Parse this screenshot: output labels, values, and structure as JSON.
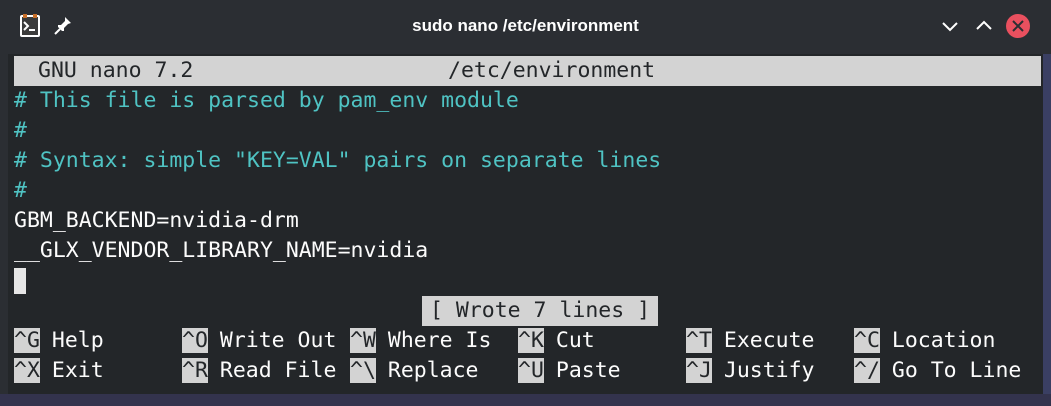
{
  "window": {
    "title": "sudo nano /etc/environment"
  },
  "editor": {
    "version": "GNU nano 7.2",
    "filename": "/etc/environment",
    "lines": [
      "# This file is parsed by pam_env module",
      "#",
      "# Syntax: simple \"KEY=VAL\" pairs on separate lines",
      "#",
      "GBM_BACKEND=nvidia-drm",
      "__GLX_VENDOR_LIBRARY_NAME=nvidia"
    ],
    "status": "[ Wrote 7 lines ]"
  },
  "shortcuts": {
    "row1": [
      {
        "key": "^G",
        "label": "Help"
      },
      {
        "key": "^O",
        "label": "Write Out"
      },
      {
        "key": "^W",
        "label": "Where Is"
      },
      {
        "key": "^K",
        "label": "Cut"
      },
      {
        "key": "^T",
        "label": "Execute"
      },
      {
        "key": "^C",
        "label": "Location"
      }
    ],
    "row2": [
      {
        "key": "^X",
        "label": "Exit"
      },
      {
        "key": "^R",
        "label": "Read File"
      },
      {
        "key": "^\\",
        "label": "Replace"
      },
      {
        "key": "^U",
        "label": "Paste"
      },
      {
        "key": "^J",
        "label": "Justify"
      },
      {
        "key": "^/",
        "label": "Go To Line"
      }
    ]
  },
  "colors": {
    "comment": "#4fc3c3",
    "close_button": "#e9505f",
    "header_bg": "#d3d3d3"
  },
  "icons": {
    "app": "terminal-app-icon",
    "pin": "pin-icon",
    "minimize": "chevron-down-icon",
    "maximize": "chevron-up-icon",
    "close": "close-icon"
  }
}
